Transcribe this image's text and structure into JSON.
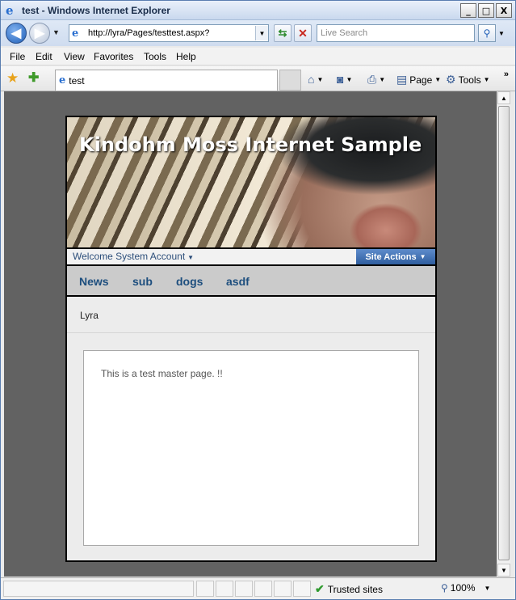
{
  "window": {
    "title": "test - Windows Internet Explorer",
    "controls": {
      "minimize": "_",
      "maximize": "□",
      "close": "X"
    }
  },
  "address_bar": {
    "url": "http://lyra/Pages/testtest.aspx?"
  },
  "search": {
    "placeholder": "Live Search"
  },
  "menu": {
    "items": [
      "File",
      "Edit",
      "View",
      "Favorites",
      "Tools",
      "Help"
    ]
  },
  "tab": {
    "label": "test"
  },
  "command_bar": {
    "page_label": "Page",
    "tools_label": "Tools",
    "overflow": "»"
  },
  "site": {
    "title": "Kindohm Moss Internet Sample",
    "welcome": "Welcome System Account",
    "site_actions": "Site Actions",
    "nav": [
      "News",
      "sub",
      "dogs",
      "asdf"
    ],
    "breadcrumb": "Lyra",
    "body_text": "This is a test master page. !!"
  },
  "status": {
    "zone": "Trusted sites",
    "zoom": "100%"
  },
  "colors": {
    "link": "#1d4e7e",
    "site_actions": "#2f5e9f",
    "viewport_bg": "#626262"
  }
}
